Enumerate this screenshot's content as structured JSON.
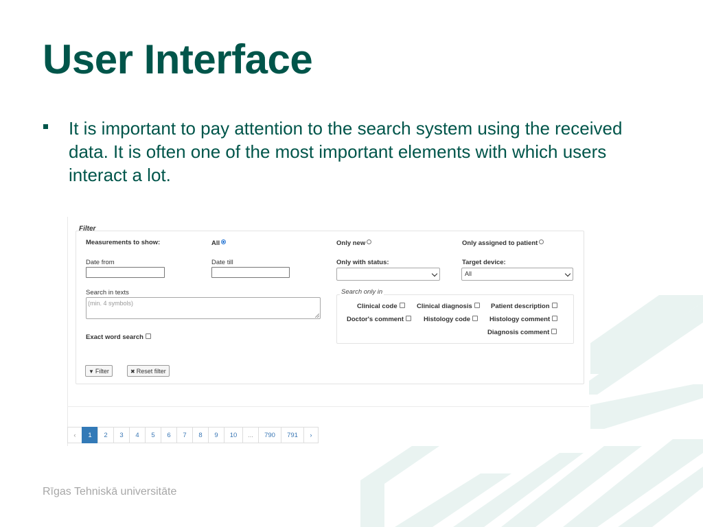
{
  "slide": {
    "title": "User Interface",
    "bullet": "It is important to pay attention to the search system using the received data. It is often one of the most important elements with which users interact a lot.",
    "footer": "Rīgas Tehniskā universitāte"
  },
  "colors": {
    "title": "#00554a",
    "footer": "#a7a7a7",
    "pattern": "#e9f3f1",
    "page_active": "#337ab7",
    "page_link": "#3a77b5"
  },
  "filter": {
    "legend": "Filter",
    "measurements_label": "Measurements to show:",
    "radio_all": "All",
    "radio_only_new": "Only new",
    "radio_only_assigned": "Only assigned to patient",
    "date_from_label": "Date from",
    "date_from_value": "",
    "date_till_label": "Date till",
    "date_till_value": "",
    "status_label": "Only with status:",
    "status_value": "",
    "device_label": "Target device:",
    "device_value": "All",
    "search_label": "Search in texts",
    "search_placeholder": "(min. 4 symbols)",
    "search_only_in_legend": "Search only in",
    "fields": {
      "clinical_code": "Clinical code",
      "clinical_diagnosis": "Clinical diagnosis",
      "patient_description": "Patient description",
      "doctors_comment": "Doctor's comment",
      "histology_code": "Histology code",
      "histology_comment": "Histology comment",
      "diagnosis_comment": "Diagnosis comment"
    },
    "exact_word_label": "Exact word search",
    "filter_button": "Filter",
    "reset_button": "Reset filter"
  },
  "pagination": {
    "prev": "‹",
    "next": "›",
    "pages": [
      "1",
      "2",
      "3",
      "4",
      "5",
      "6",
      "7",
      "8",
      "9",
      "10",
      "...",
      "790",
      "791"
    ],
    "current": "1"
  }
}
